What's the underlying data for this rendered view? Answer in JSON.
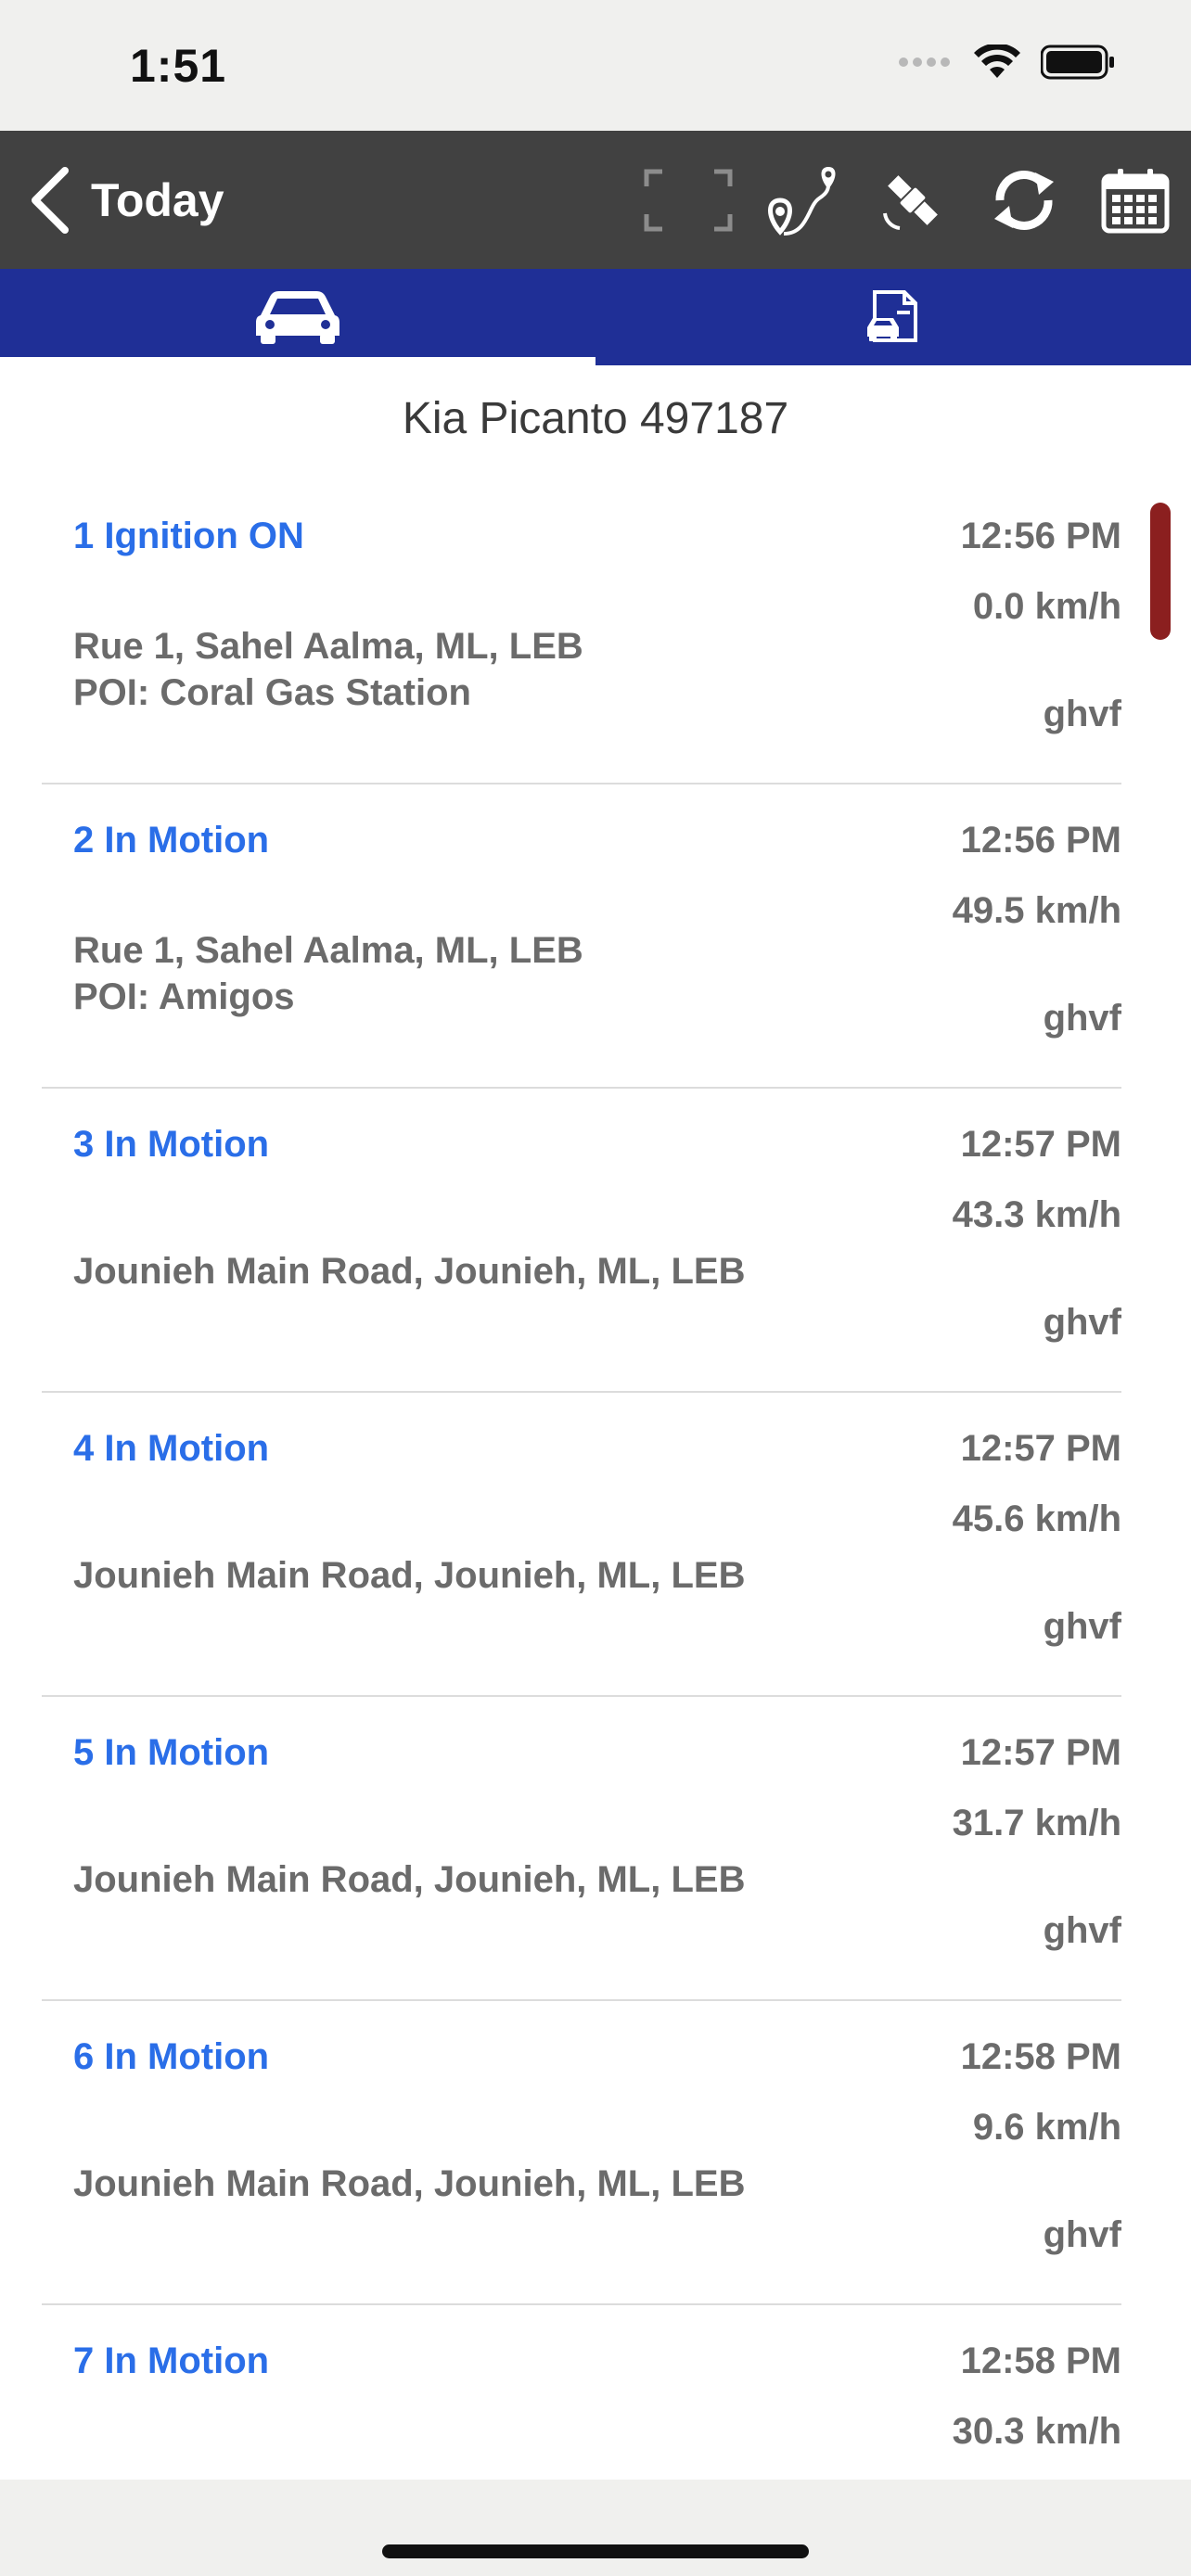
{
  "status_bar": {
    "time": "1:51",
    "icons": [
      "signal-dots-icon",
      "wifi-icon",
      "battery-icon"
    ]
  },
  "nav": {
    "back_label": "Today",
    "toolbar_icons": [
      "fullscreen-icon",
      "route-icon",
      "satellite-icon",
      "refresh-icon",
      "calendar-icon"
    ]
  },
  "tabs": [
    {
      "icon": "car-icon",
      "selected": true
    },
    {
      "icon": "car-document-icon",
      "selected": false
    }
  ],
  "vehicle_title": "Kia Picanto 497187",
  "events": [
    {
      "title": "1 Ignition ON",
      "time": "12:56 PM",
      "speed": "0.0 km/h",
      "address": "Rue 1, Sahel Aalma, ML, LEB",
      "poi": "POI: Coral Gas Station",
      "user": "ghvf"
    },
    {
      "title": "2 In Motion",
      "time": "12:56 PM",
      "speed": "49.5 km/h",
      "address": "Rue 1, Sahel Aalma, ML, LEB",
      "poi": "POI: Amigos",
      "user": "ghvf"
    },
    {
      "title": "3 In Motion",
      "time": "12:57 PM",
      "speed": "43.3 km/h",
      "address": "Jounieh Main Road, Jounieh, ML, LEB",
      "poi": "",
      "user": "ghvf"
    },
    {
      "title": "4 In Motion",
      "time": "12:57 PM",
      "speed": "45.6 km/h",
      "address": "Jounieh Main Road, Jounieh, ML, LEB",
      "poi": "",
      "user": "ghvf"
    },
    {
      "title": "5 In Motion",
      "time": "12:57 PM",
      "speed": "31.7 km/h",
      "address": "Jounieh Main Road, Jounieh, ML, LEB",
      "poi": "",
      "user": "ghvf"
    },
    {
      "title": "6 In Motion",
      "time": "12:58 PM",
      "speed": "9.6 km/h",
      "address": "Jounieh Main Road, Jounieh, ML, LEB",
      "poi": "",
      "user": "ghvf"
    },
    {
      "title": "7 In Motion",
      "time": "12:58 PM",
      "speed": "30.3 km/h",
      "address": "",
      "poi": "",
      "user": ""
    }
  ],
  "colors": {
    "nav_background": "#414141",
    "tab_background": "#1f2f96",
    "event_title": "#2a6ee8",
    "scroll_indicator": "#8b1f1f"
  }
}
